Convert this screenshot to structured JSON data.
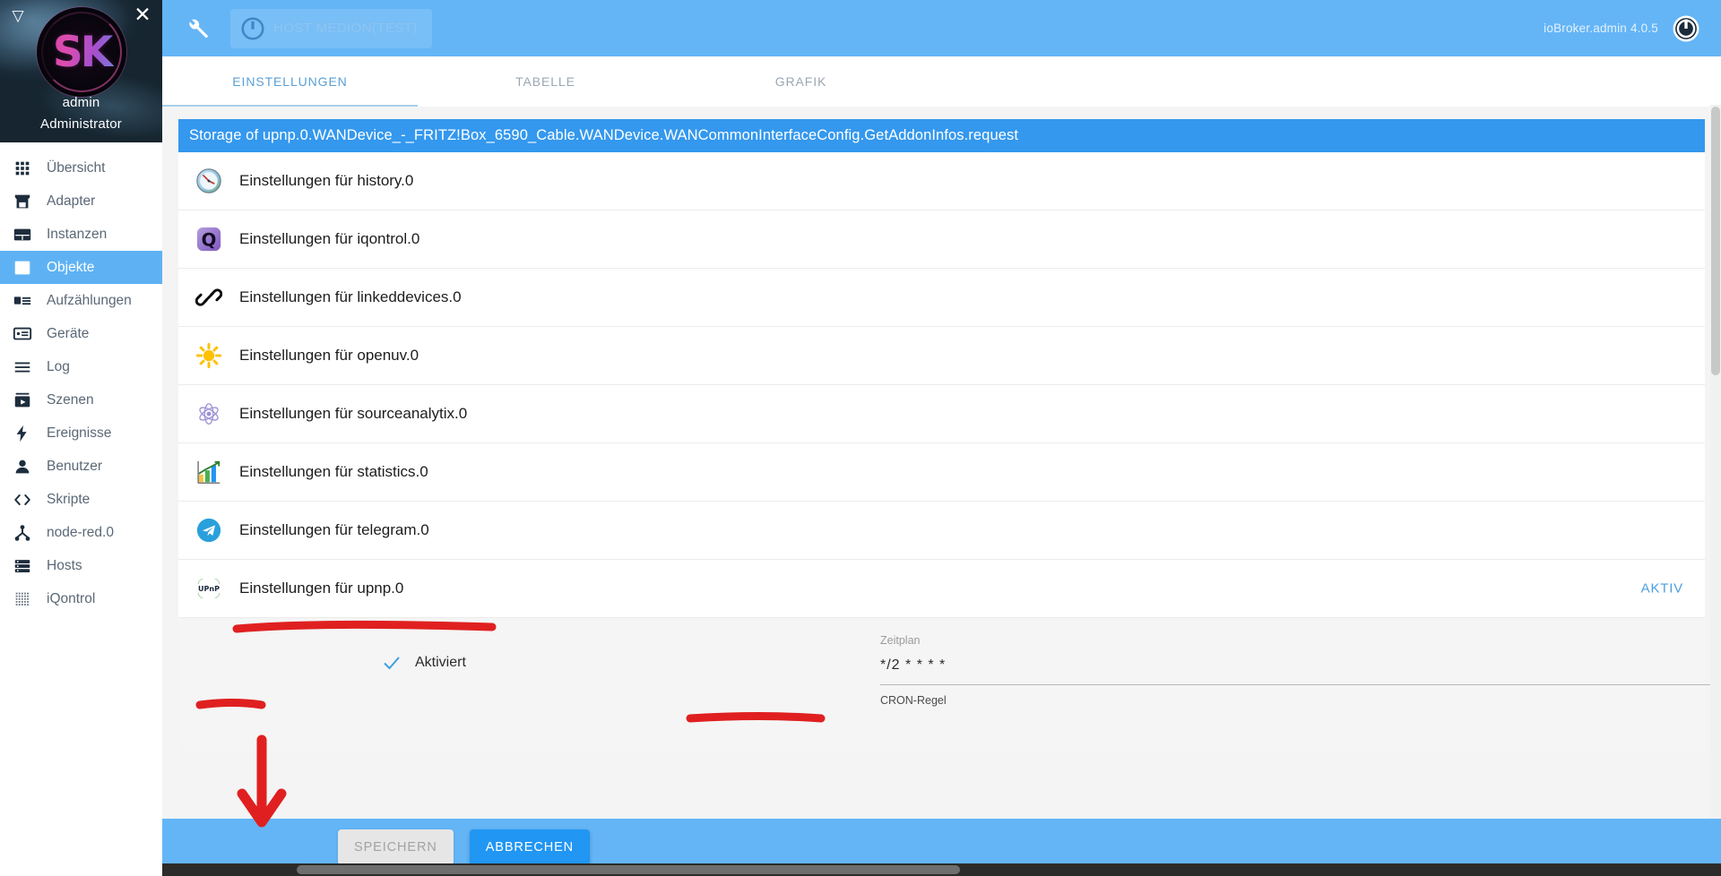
{
  "sidebar": {
    "caret_icon": "caret-down-icon",
    "close_icon": "close-icon",
    "avatar_text": "SK",
    "user": "admin",
    "role": "Administrator",
    "items": [
      {
        "label": "Übersicht",
        "icon": "grid-icon",
        "active": false
      },
      {
        "label": "Adapter",
        "icon": "store-icon",
        "active": false
      },
      {
        "label": "Instanzen",
        "icon": "instances-icon",
        "active": false
      },
      {
        "label": "Objekte",
        "icon": "list-icon",
        "active": true
      },
      {
        "label": "Aufzählungen",
        "icon": "enum-icon",
        "active": false
      },
      {
        "label": "Geräte",
        "icon": "device-icon",
        "active": false
      },
      {
        "label": "Log",
        "icon": "lines-icon",
        "active": false
      },
      {
        "label": "Szenen",
        "icon": "scene-icon",
        "active": false
      },
      {
        "label": "Ereignisse",
        "icon": "bolt-icon",
        "active": false
      },
      {
        "label": "Benutzer",
        "icon": "person-icon",
        "active": false
      },
      {
        "label": "Skripte",
        "icon": "code-icon",
        "active": false
      },
      {
        "label": "node-red.0",
        "icon": "nodered-icon",
        "active": false
      },
      {
        "label": "Hosts",
        "icon": "server-icon",
        "active": false
      },
      {
        "label": "iQontrol",
        "icon": "dots-icon",
        "active": false
      }
    ]
  },
  "topbar": {
    "wrench_icon": "wrench-icon",
    "host_power_icon": "power-icon",
    "host_label": "HOST MEDION(TEST)",
    "version": "ioBroker.admin 4.0.5",
    "logo_icon": "iobroker-logo-icon"
  },
  "tabs": [
    {
      "label": "EINSTELLUNGEN",
      "active": true
    },
    {
      "label": "TABELLE",
      "active": false
    },
    {
      "label": "GRAFIK",
      "active": false
    }
  ],
  "storage": {
    "title": "Storage of upnp.0.WANDevice_-_FRITZ!Box_6590_Cable.WANDevice.WANCommonInterfaceConfig.GetAddonInfos.request",
    "background": "#3498ee"
  },
  "rows": [
    {
      "label": "Einstellungen für history.0",
      "icon": "history-clock-icon",
      "status": ""
    },
    {
      "label": "Einstellungen für iqontrol.0",
      "icon": "iqontrol-q-icon",
      "status": ""
    },
    {
      "label": "Einstellungen für linkeddevices.0",
      "icon": "chain-link-icon",
      "status": ""
    },
    {
      "label": "Einstellungen für openuv.0",
      "icon": "sun-icon",
      "status": ""
    },
    {
      "label": "Einstellungen für sourceanalytix.0",
      "icon": "atom-icon",
      "status": ""
    },
    {
      "label": "Einstellungen für statistics.0",
      "icon": "bar-chart-icon",
      "status": ""
    },
    {
      "label": "Einstellungen für telegram.0",
      "icon": "telegram-plane-icon",
      "status": ""
    },
    {
      "label": "Einstellungen für upnp.0",
      "icon": "upnp-text-icon",
      "status": "AKTIV"
    }
  ],
  "settings": {
    "checkbox_icon": "checkmark-icon",
    "checkbox_label": "Aktiviert",
    "schedule_label": "Zeitplan",
    "schedule_value": "*/2 * * * *",
    "schedule_help": "CRON-Regel",
    "clock_icon": "clock-icon"
  },
  "footer": {
    "save_label": "SPEICHERN",
    "cancel_label": "ABBRECHEN",
    "accent": "#2196f3"
  },
  "annotations": {
    "color": "#e02020",
    "arrow_icon": "down-arrow-annotation-icon"
  }
}
